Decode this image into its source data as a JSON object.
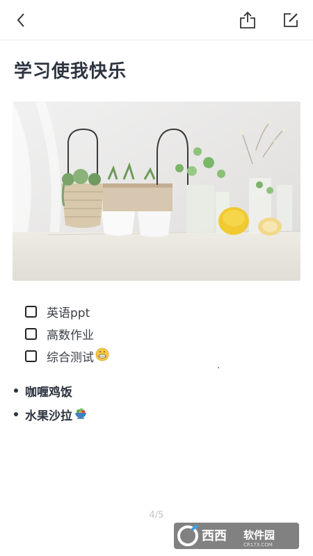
{
  "toolbar": {
    "back_icon": "chevron-left-icon",
    "share_icon": "share-icon",
    "edit_icon": "edit-icon"
  },
  "note": {
    "title": "学习使我快乐",
    "image_alt": "plants-on-table-photo",
    "checklist": [
      {
        "label": "英语ppt",
        "checked": false
      },
      {
        "label": "高数作业",
        "checked": false
      },
      {
        "label": "综合测试",
        "checked": false,
        "emoji": "grinning-face"
      }
    ],
    "bullets": [
      {
        "label": "咖喱鸡饭"
      },
      {
        "label": "水果沙拉",
        "emoji": "salad-bowl"
      }
    ]
  },
  "pagination": {
    "text": "4/5"
  },
  "watermark": {
    "text": "西西软件园",
    "subtext": "CR173.COM"
  },
  "colors": {
    "text": "#2d3440",
    "page_number": "#c4c4c4",
    "accent": "#3aa0e8"
  }
}
